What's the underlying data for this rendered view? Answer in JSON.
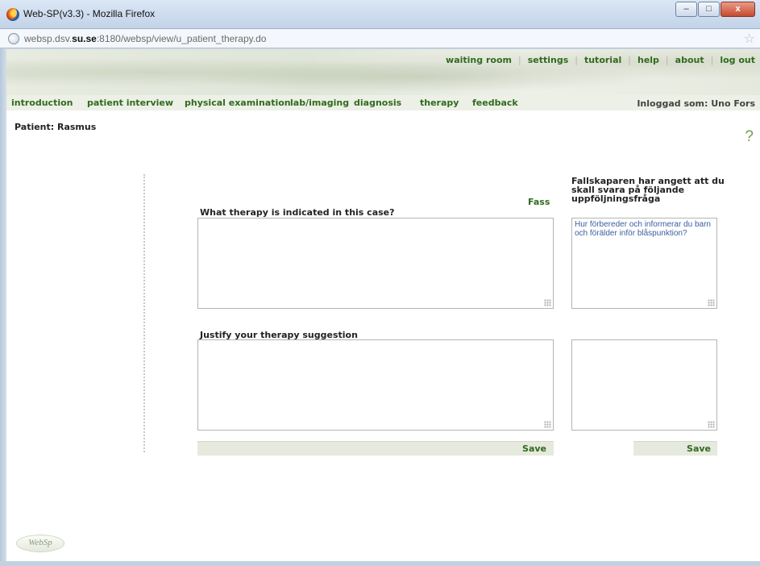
{
  "window": {
    "title": "Web-SP(v3.3) - Mozilla Firefox",
    "min_label": "–",
    "max_label": "□",
    "close_label": "x"
  },
  "address": {
    "url_prefix": "websp.dsv.",
    "url_domain": "su.se",
    "url_suffix": ":8180/websp/view/u_patient_therapy.do"
  },
  "top_links": [
    "waiting room",
    "settings",
    "tutorial",
    "help",
    "about",
    "log out"
  ],
  "nav": {
    "items": [
      "introduction",
      "patient interview",
      "physical examination",
      "lab/imaging",
      "diagnosis",
      "therapy",
      "feedback"
    ],
    "logged_in": "Inloggad som: Uno Fors"
  },
  "patient": {
    "label": "Patient: Rasmus"
  },
  "help_symbol": "?",
  "therapy": {
    "question": "What therapy is indicated in this case?",
    "fass_link": "Fass",
    "justify_label": "Justify your therapy suggestion",
    "therapy_value": "",
    "justify_value": ""
  },
  "followup": {
    "title": "Fallskaparen har angett att du skall svara på följande uppföljningsfråga",
    "question": "Hur förbereder och informerar du barn och förälder inför blåspunktion?",
    "answer_value": ""
  },
  "save_left": "Save",
  "save_right": "Save",
  "logo_text": "WebSp",
  "colors": {
    "link_green": "#2f6b1e",
    "question_blue": "#3a5fa0"
  }
}
